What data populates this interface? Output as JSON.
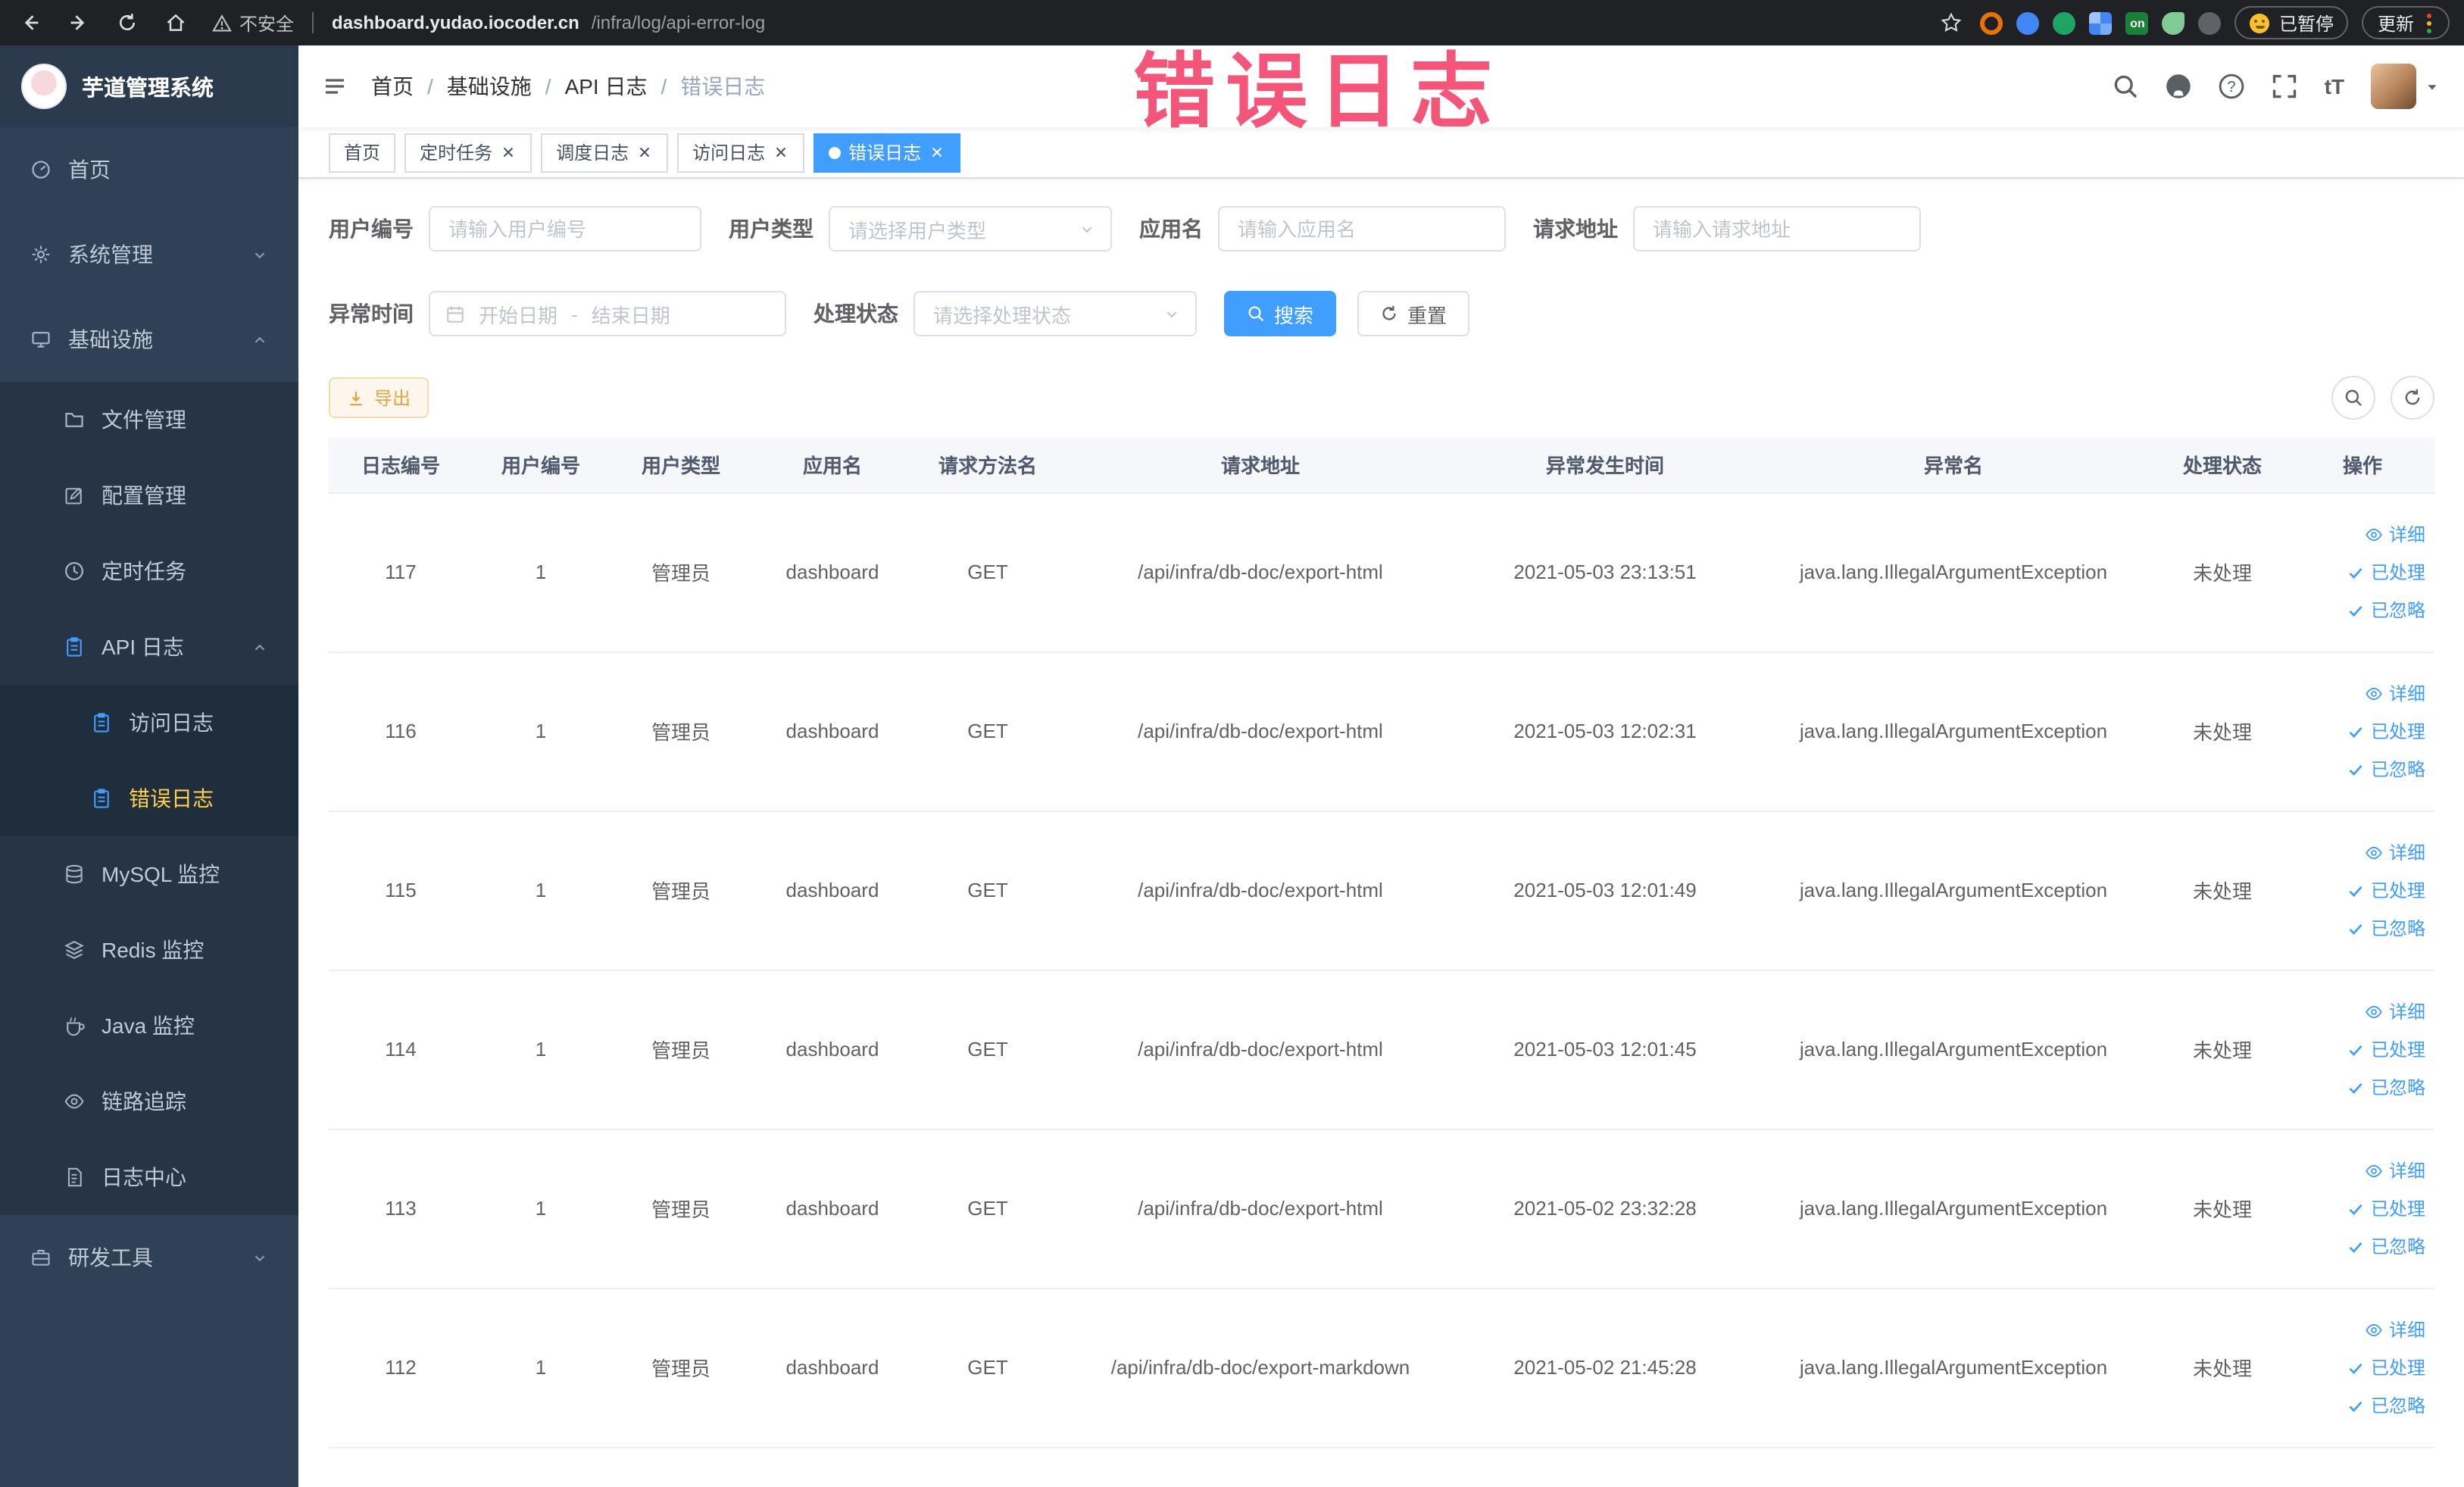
{
  "browser": {
    "security_label": "不安全",
    "url_domain": "dashboard.yudao.iocoder.cn",
    "url_path": "/infra/log/api-error-log",
    "extension_on_badge": "on",
    "paused_badge": "已暂停",
    "update_label": "更新"
  },
  "watermark": "错误日志",
  "sidebar": {
    "logo_title": "芋道管理系统",
    "items": [
      {
        "label": "首页"
      },
      {
        "label": "系统管理"
      },
      {
        "label": "基础设施"
      },
      {
        "label": "文件管理"
      },
      {
        "label": "配置管理"
      },
      {
        "label": "定时任务"
      },
      {
        "label": "API 日志"
      },
      {
        "label": "访问日志"
      },
      {
        "label": "错误日志"
      },
      {
        "label": "MySQL 监控"
      },
      {
        "label": "Redis 监控"
      },
      {
        "label": "Java 监控"
      },
      {
        "label": "链路追踪"
      },
      {
        "label": "日志中心"
      },
      {
        "label": "研发工具"
      }
    ]
  },
  "header": {
    "breadcrumb": [
      "首页",
      "基础设施",
      "API 日志",
      "错误日志"
    ],
    "breadcrumb_separator": "/",
    "font_size_icon_text": "tT"
  },
  "tabs": [
    {
      "label": "首页"
    },
    {
      "label": "定时任务"
    },
    {
      "label": "调度日志"
    },
    {
      "label": "访问日志"
    },
    {
      "label": "错误日志"
    }
  ],
  "filters": {
    "user_id_label": "用户编号",
    "user_id_placeholder": "请输入用户编号",
    "user_type_label": "用户类型",
    "user_type_placeholder": "请选择用户类型",
    "app_name_label": "应用名",
    "app_name_placeholder": "请输入应用名",
    "request_url_label": "请求地址",
    "request_url_placeholder": "请输入请求地址",
    "exception_time_label": "异常时间",
    "start_date_placeholder": "开始日期",
    "date_separator": "-",
    "end_date_placeholder": "结束日期",
    "process_status_label": "处理状态",
    "process_status_placeholder": "请选择处理状态",
    "search_label": "搜索",
    "reset_label": "重置"
  },
  "toolbar": {
    "export_label": "导出"
  },
  "table": {
    "columns": [
      "日志编号",
      "用户编号",
      "用户类型",
      "应用名",
      "请求方法名",
      "请求地址",
      "异常发生时间",
      "异常名",
      "处理状态",
      "操作"
    ],
    "actions": {
      "detail": "详细",
      "processed": "已处理",
      "ignore": "已忽略"
    },
    "rows": [
      {
        "log_id": "117",
        "user_id": "1",
        "user_type": "管理员",
        "app_name": "dashboard",
        "method": "GET",
        "url": "/api/infra/db-doc/export-html",
        "time": "2021-05-03 23:13:51",
        "exception": "java.lang.IllegalArgumentException",
        "status": "未处理"
      },
      {
        "log_id": "116",
        "user_id": "1",
        "user_type": "管理员",
        "app_name": "dashboard",
        "method": "GET",
        "url": "/api/infra/db-doc/export-html",
        "time": "2021-05-03 12:02:31",
        "exception": "java.lang.IllegalArgumentException",
        "status": "未处理"
      },
      {
        "log_id": "115",
        "user_id": "1",
        "user_type": "管理员",
        "app_name": "dashboard",
        "method": "GET",
        "url": "/api/infra/db-doc/export-html",
        "time": "2021-05-03 12:01:49",
        "exception": "java.lang.IllegalArgumentException",
        "status": "未处理"
      },
      {
        "log_id": "114",
        "user_id": "1",
        "user_type": "管理员",
        "app_name": "dashboard",
        "method": "GET",
        "url": "/api/infra/db-doc/export-html",
        "time": "2021-05-03 12:01:45",
        "exception": "java.lang.IllegalArgumentException",
        "status": "未处理"
      },
      {
        "log_id": "113",
        "user_id": "1",
        "user_type": "管理员",
        "app_name": "dashboard",
        "method": "GET",
        "url": "/api/infra/db-doc/export-html",
        "time": "2021-05-02 23:32:28",
        "exception": "java.lang.IllegalArgumentException",
        "status": "未处理"
      },
      {
        "log_id": "112",
        "user_id": "1",
        "user_type": "管理员",
        "app_name": "dashboard",
        "method": "GET",
        "url": "/api/infra/db-doc/export-markdown",
        "time": "2021-05-02 21:45:28",
        "exception": "java.lang.IllegalArgumentException",
        "status": "未处理"
      }
    ]
  }
}
